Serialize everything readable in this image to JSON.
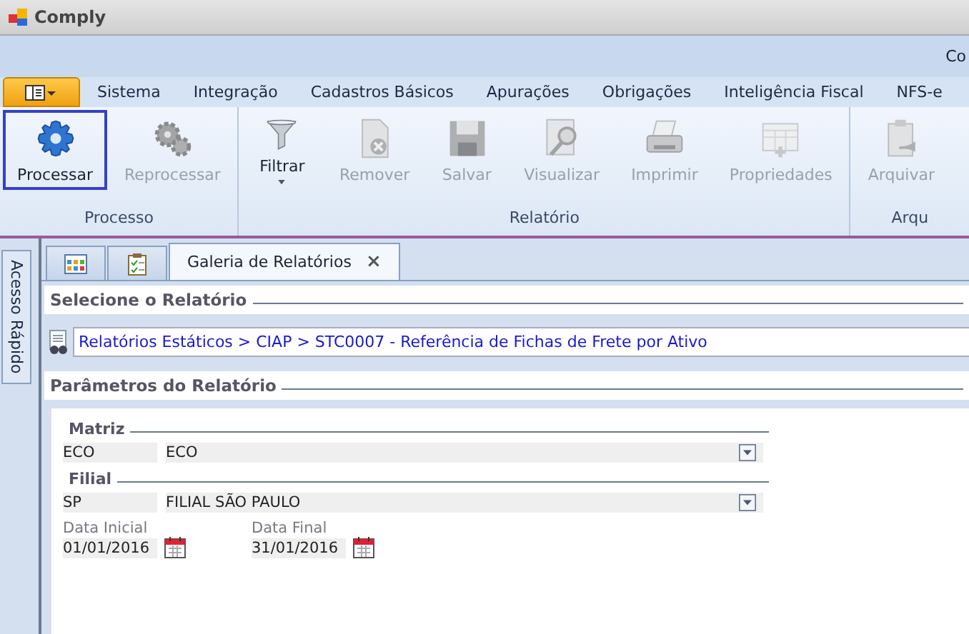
{
  "window": {
    "title": "Comply",
    "band_text": "Co"
  },
  "menu_tabs": [
    {
      "label": "Sistema",
      "selected": false
    },
    {
      "label": "Integração",
      "selected": false
    },
    {
      "label": "Cadastros Básicos",
      "selected": false
    },
    {
      "label": "Apurações",
      "selected": false
    },
    {
      "label": "Obrigações",
      "selected": false
    },
    {
      "label": "Inteligência Fiscal",
      "selected": false
    },
    {
      "label": "NFS-e",
      "selected": false
    }
  ],
  "ribbon_groups": [
    {
      "label": "Processo",
      "buttons": [
        {
          "label": "Processar",
          "kind": "gear",
          "disabled": false,
          "selected": true,
          "dropdown": false
        },
        {
          "label": "Reprocessar",
          "kind": "gears",
          "disabled": true,
          "selected": false,
          "dropdown": false
        }
      ]
    },
    {
      "label": "Relatório",
      "buttons": [
        {
          "label": "Filtrar",
          "kind": "funnel",
          "disabled": false,
          "selected": false,
          "dropdown": true
        },
        {
          "label": "Remover",
          "kind": "remove",
          "disabled": true,
          "selected": false,
          "dropdown": false
        },
        {
          "label": "Salvar",
          "kind": "floppy",
          "disabled": true,
          "selected": false,
          "dropdown": false
        },
        {
          "label": "Visualizar",
          "kind": "magnifier",
          "disabled": true,
          "selected": false,
          "dropdown": false
        },
        {
          "label": "Imprimir",
          "kind": "printer",
          "disabled": true,
          "selected": false,
          "dropdown": false
        },
        {
          "label": "Propriedades",
          "kind": "table",
          "disabled": true,
          "selected": false,
          "dropdown": false
        }
      ]
    },
    {
      "label": "Arqu",
      "buttons": [
        {
          "label": "Arquivar",
          "kind": "clipboard",
          "disabled": true,
          "selected": false,
          "dropdown": false
        }
      ]
    }
  ],
  "side_tab": "Acesso Rápido",
  "doc_tabs": [
    {
      "kind": "grid",
      "selected": false
    },
    {
      "kind": "checklist",
      "selected": false
    },
    {
      "kind": "text",
      "label": "Galeria de Relatórios",
      "close": "×",
      "selected": true
    }
  ],
  "select_section": {
    "title": "Selecione o Relatório",
    "path": "Relatórios Estáticos > CIAP > STC0007 - Referência de Fichas de Frete por Ativo"
  },
  "params_section": {
    "title": "Parâmetros do Relatório",
    "groups": [
      {
        "title": "Matriz",
        "code": "ECO",
        "name": "ECO"
      },
      {
        "title": "Filial",
        "code": "SP",
        "name": "FILIAL SÃO PAULO"
      }
    ],
    "dates": [
      {
        "label": "Data Inicial",
        "value": "01/01/2016"
      },
      {
        "label": "Data Final",
        "value": "31/01/2016"
      }
    ]
  }
}
